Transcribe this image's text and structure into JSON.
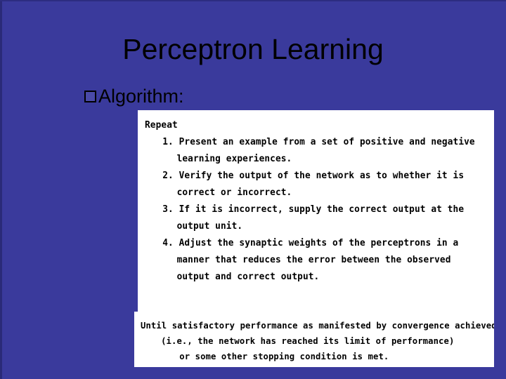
{
  "slide": {
    "title": "Perceptron Learning",
    "background_color": "#3a3a9c",
    "title_color": "#000000",
    "bullet": {
      "marker": "box-bullet-icon",
      "label": "Algorithm:"
    }
  },
  "algorithm_image": {
    "panel_background": "#ffffff",
    "top_panel": {
      "header": "Repeat",
      "steps": [
        {
          "number": "1.",
          "lines": [
            "Present an example from a set of positive and negative",
            "learning experiences."
          ]
        },
        {
          "number": "2.",
          "lines": [
            "Verify the output of the network as to whether it is",
            "correct or incorrect."
          ]
        },
        {
          "number": "3.",
          "lines": [
            "If it is incorrect, supply the correct output at the",
            "output unit."
          ]
        },
        {
          "number": "4.",
          "lines": [
            "Adjust the synaptic weights of the perceptrons in a",
            "manner that reduces the error between the observed",
            "output and correct output."
          ]
        }
      ]
    },
    "bottom_panel": {
      "lines": [
        "Until satisfactory performance as manifested by convergence achieved",
        "(i.e., the network has reached its limit of performance)",
        "or some other stopping condition is met."
      ]
    }
  }
}
